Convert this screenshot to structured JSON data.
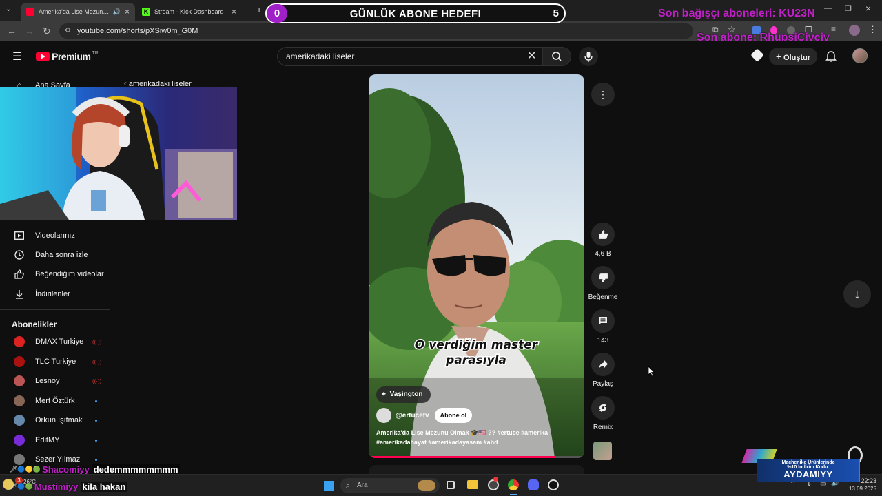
{
  "browser": {
    "tabs": [
      {
        "title": "Amerika'da Lise Mezunu Olma",
        "active": true
      },
      {
        "title": "Stream - Kick Dashboard",
        "active": false
      }
    ],
    "url": "youtube.com/shorts/pXSiw0m_G0M"
  },
  "overlay": {
    "goal_current": "0",
    "goal_label": "GÜNLÜK ABONE HEDEFI",
    "goal_target": "5",
    "last_donors": "Son bağışçı aboneleri: KU23N",
    "last_sub": "Son abone: RhupsiCivciv"
  },
  "youtube": {
    "logo": "Premium",
    "logo_sup": "TR",
    "search_value": "amerikadaki liseler",
    "create_label": "Oluştur"
  },
  "sidebar": {
    "top_partial": "Ana Sayfa",
    "breadcrumb_partial": "amerikadaki liseler",
    "items": [
      {
        "label": "Videolarınız",
        "icon": "video-icon"
      },
      {
        "label": "Daha sonra izle",
        "icon": "clock-icon"
      },
      {
        "label": "Beğendiğim videolar",
        "icon": "thumb-up-icon"
      },
      {
        "label": "İndirilenler",
        "icon": "download-icon"
      }
    ],
    "subs_title": "Abonelikler",
    "subs": [
      {
        "label": "DMAX Turkiye",
        "color": "#d22"
      },
      {
        "label": "TLC Turkiye",
        "color": "#a11"
      },
      {
        "label": "Lesnoy",
        "color": "#b55"
      },
      {
        "label": "Mert Öztürk",
        "color": "#865"
      },
      {
        "label": "Orkun Işıtmak",
        "color": "#68a"
      },
      {
        "label": "EditMY",
        "color": "#7a2bd8"
      },
      {
        "label": "Sezer Yılmaz",
        "color": "#777"
      }
    ]
  },
  "short": {
    "caption_line1": "O verdiğim master",
    "caption_line2": "parasıyla",
    "location": "Vaşington",
    "channel": "@ertucetv",
    "subscribe": "Abone ol",
    "title_line1": "Amerika'da Lise Mezunu Olmak 🎓🇺🇸 ?? #ertuce #amerika",
    "title_line2": "#amerikadahayat #amerikadayasam #abd",
    "actions": {
      "likes": "4,6 B",
      "dislike": "Beğenme",
      "comments": "143",
      "share": "Paylaş",
      "remix": "Remix"
    }
  },
  "chat": [
    {
      "user": "Shacomiyy",
      "msg": "dedemmmmmmmm",
      "user_color": "#c020c8"
    },
    {
      "user": "Mustimiyy",
      "msg": "kila hakan",
      "user_color": "#c020c8"
    }
  ],
  "ad": {
    "line1": "Machenike Ürünlerinde",
    "line2": "%10 İndirim Kodu:",
    "code": "AYDAMIYY"
  },
  "taskbar": {
    "weather": "26°C",
    "search": "Ara",
    "time": "22:23",
    "date": "13.09.2025",
    "notif": "3"
  },
  "colors": {
    "accent": "#a020c8",
    "yt_red": "#ff0033",
    "progress": "#ff0050"
  },
  "progress_fraction": 0.87
}
